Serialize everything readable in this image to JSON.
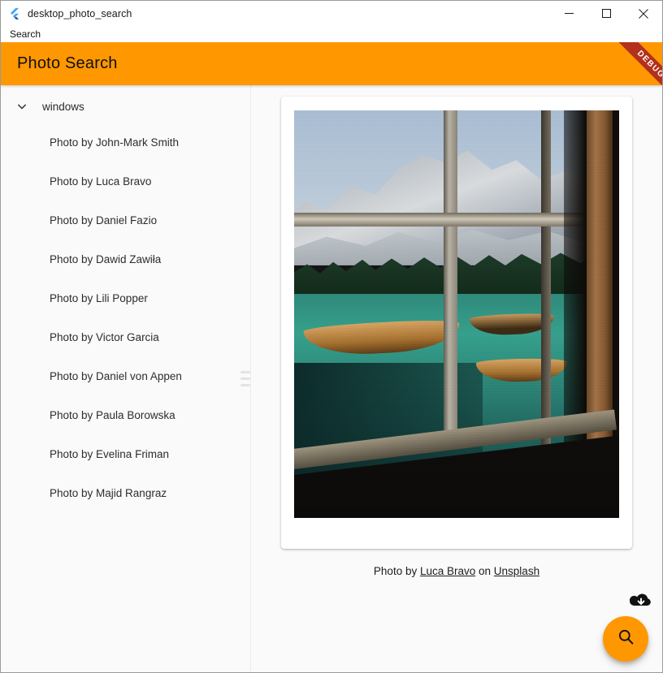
{
  "window": {
    "title": "desktop_photo_search",
    "logo_icon": "flutter-logo-icon",
    "controls": {
      "minimize": "minimize-icon",
      "maximize": "maximize-icon",
      "close": "close-icon"
    }
  },
  "menubar": {
    "items": [
      {
        "label": "Search"
      }
    ]
  },
  "appbar": {
    "title": "Photo Search",
    "background_color": "#FF9800",
    "debug_banner": {
      "label": "DEBUG",
      "color": "#B3301C"
    }
  },
  "sidebar": {
    "group": {
      "label": "windows",
      "expanded": true,
      "icon": "chevron-down-icon"
    },
    "items": [
      {
        "label": "Photo by John-Mark Smith"
      },
      {
        "label": "Photo by Luca Bravo"
      },
      {
        "label": "Photo by Daniel Fazio"
      },
      {
        "label": "Photo by Dawid Zawiła"
      },
      {
        "label": "Photo by Lili Popper"
      },
      {
        "label": "Photo by Victor Garcia"
      },
      {
        "label": "Photo by Daniel von Appen"
      },
      {
        "label": "Photo by Paula Borowska"
      },
      {
        "label": "Photo by Evelina Friman"
      },
      {
        "label": "Photo by Majid Rangraz"
      }
    ]
  },
  "splitter": {
    "icon": "drag-handle-icon"
  },
  "content": {
    "photo": {
      "alt": "Wooden rowboats on a turquoise alpine lake seen through an old window frame with snowy mountains beyond"
    },
    "attribution": {
      "prefix": "Photo by ",
      "author": "Luca Bravo",
      "middle": " on ",
      "source": "Unsplash"
    },
    "download_icon": "cloud-download-icon",
    "fab": {
      "icon": "search-icon",
      "color": "#FF9800"
    }
  }
}
